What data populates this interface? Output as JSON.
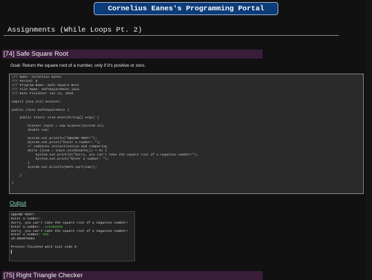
{
  "header": {
    "portal_title": "Cornelius Eanes's Programming Portal",
    "page_title": "Assignments (While Loops Pt. 2)"
  },
  "assignment_74": {
    "heading": "[74] Safe Square Root",
    "goal": "Goal: Return the square root of a number, only if it's positive or zero.",
    "code_lines": [
      "/// Name: Cornelius Eanes",
      "/// Period: 5",
      "/// Program Name: Safe Square Root",
      "/// File Name: SafeSquareRoot.java",
      "/// Date Finished: Jan 13, 2016",
      "",
      "import java.util.Scanner;",
      "",
      "public class SafeSquareRoot {",
      "",
      "    public static void main(String[] args) {",
      "",
      "        Scanner input = new Scanner(System.in);",
      "        double num;",
      "",
      "        System.out.println(\"SQUARE ROOT!\");",
      "        System.out.print(\"Enter a number: \");",
      "        // combines initialization and comparing",
      "        while ((num = input.nextDouble()) < 0) {",
      "            System.out.println(\"Sorry, you can't take the square root of a negative number!\");",
      "            System.out.print(\"Enter a number: \");",
      "        }",
      "        System.out.println(Math.sqrt(num));",
      "",
      "    }",
      "",
      "}"
    ],
    "output_label": "Output",
    "output": {
      "l1": "SQUARE ROOT!",
      "l2_prompt": "Enter a number: ",
      "l3": "Sorry, you can't take the square root of a negative number!",
      "l4_prompt": "Enter a number: ",
      "l4_input": "-123456890",
      "l5": "Sorry, you can't take the square root of a negative number!",
      "l6_prompt": "Enter a number: ",
      "l6_input": "666",
      "l7": "25.806975801",
      "l8": "",
      "l9": "Process finished with exit code 0"
    }
  },
  "assignment_75": {
    "heading": "[75] Right Triangle Checker"
  },
  "colors": {
    "portal_bg": "#0b3b78",
    "section_header_bg": "#3a1d3a",
    "output_link": "#8fd6c8",
    "user_input": "#4ec24e"
  }
}
